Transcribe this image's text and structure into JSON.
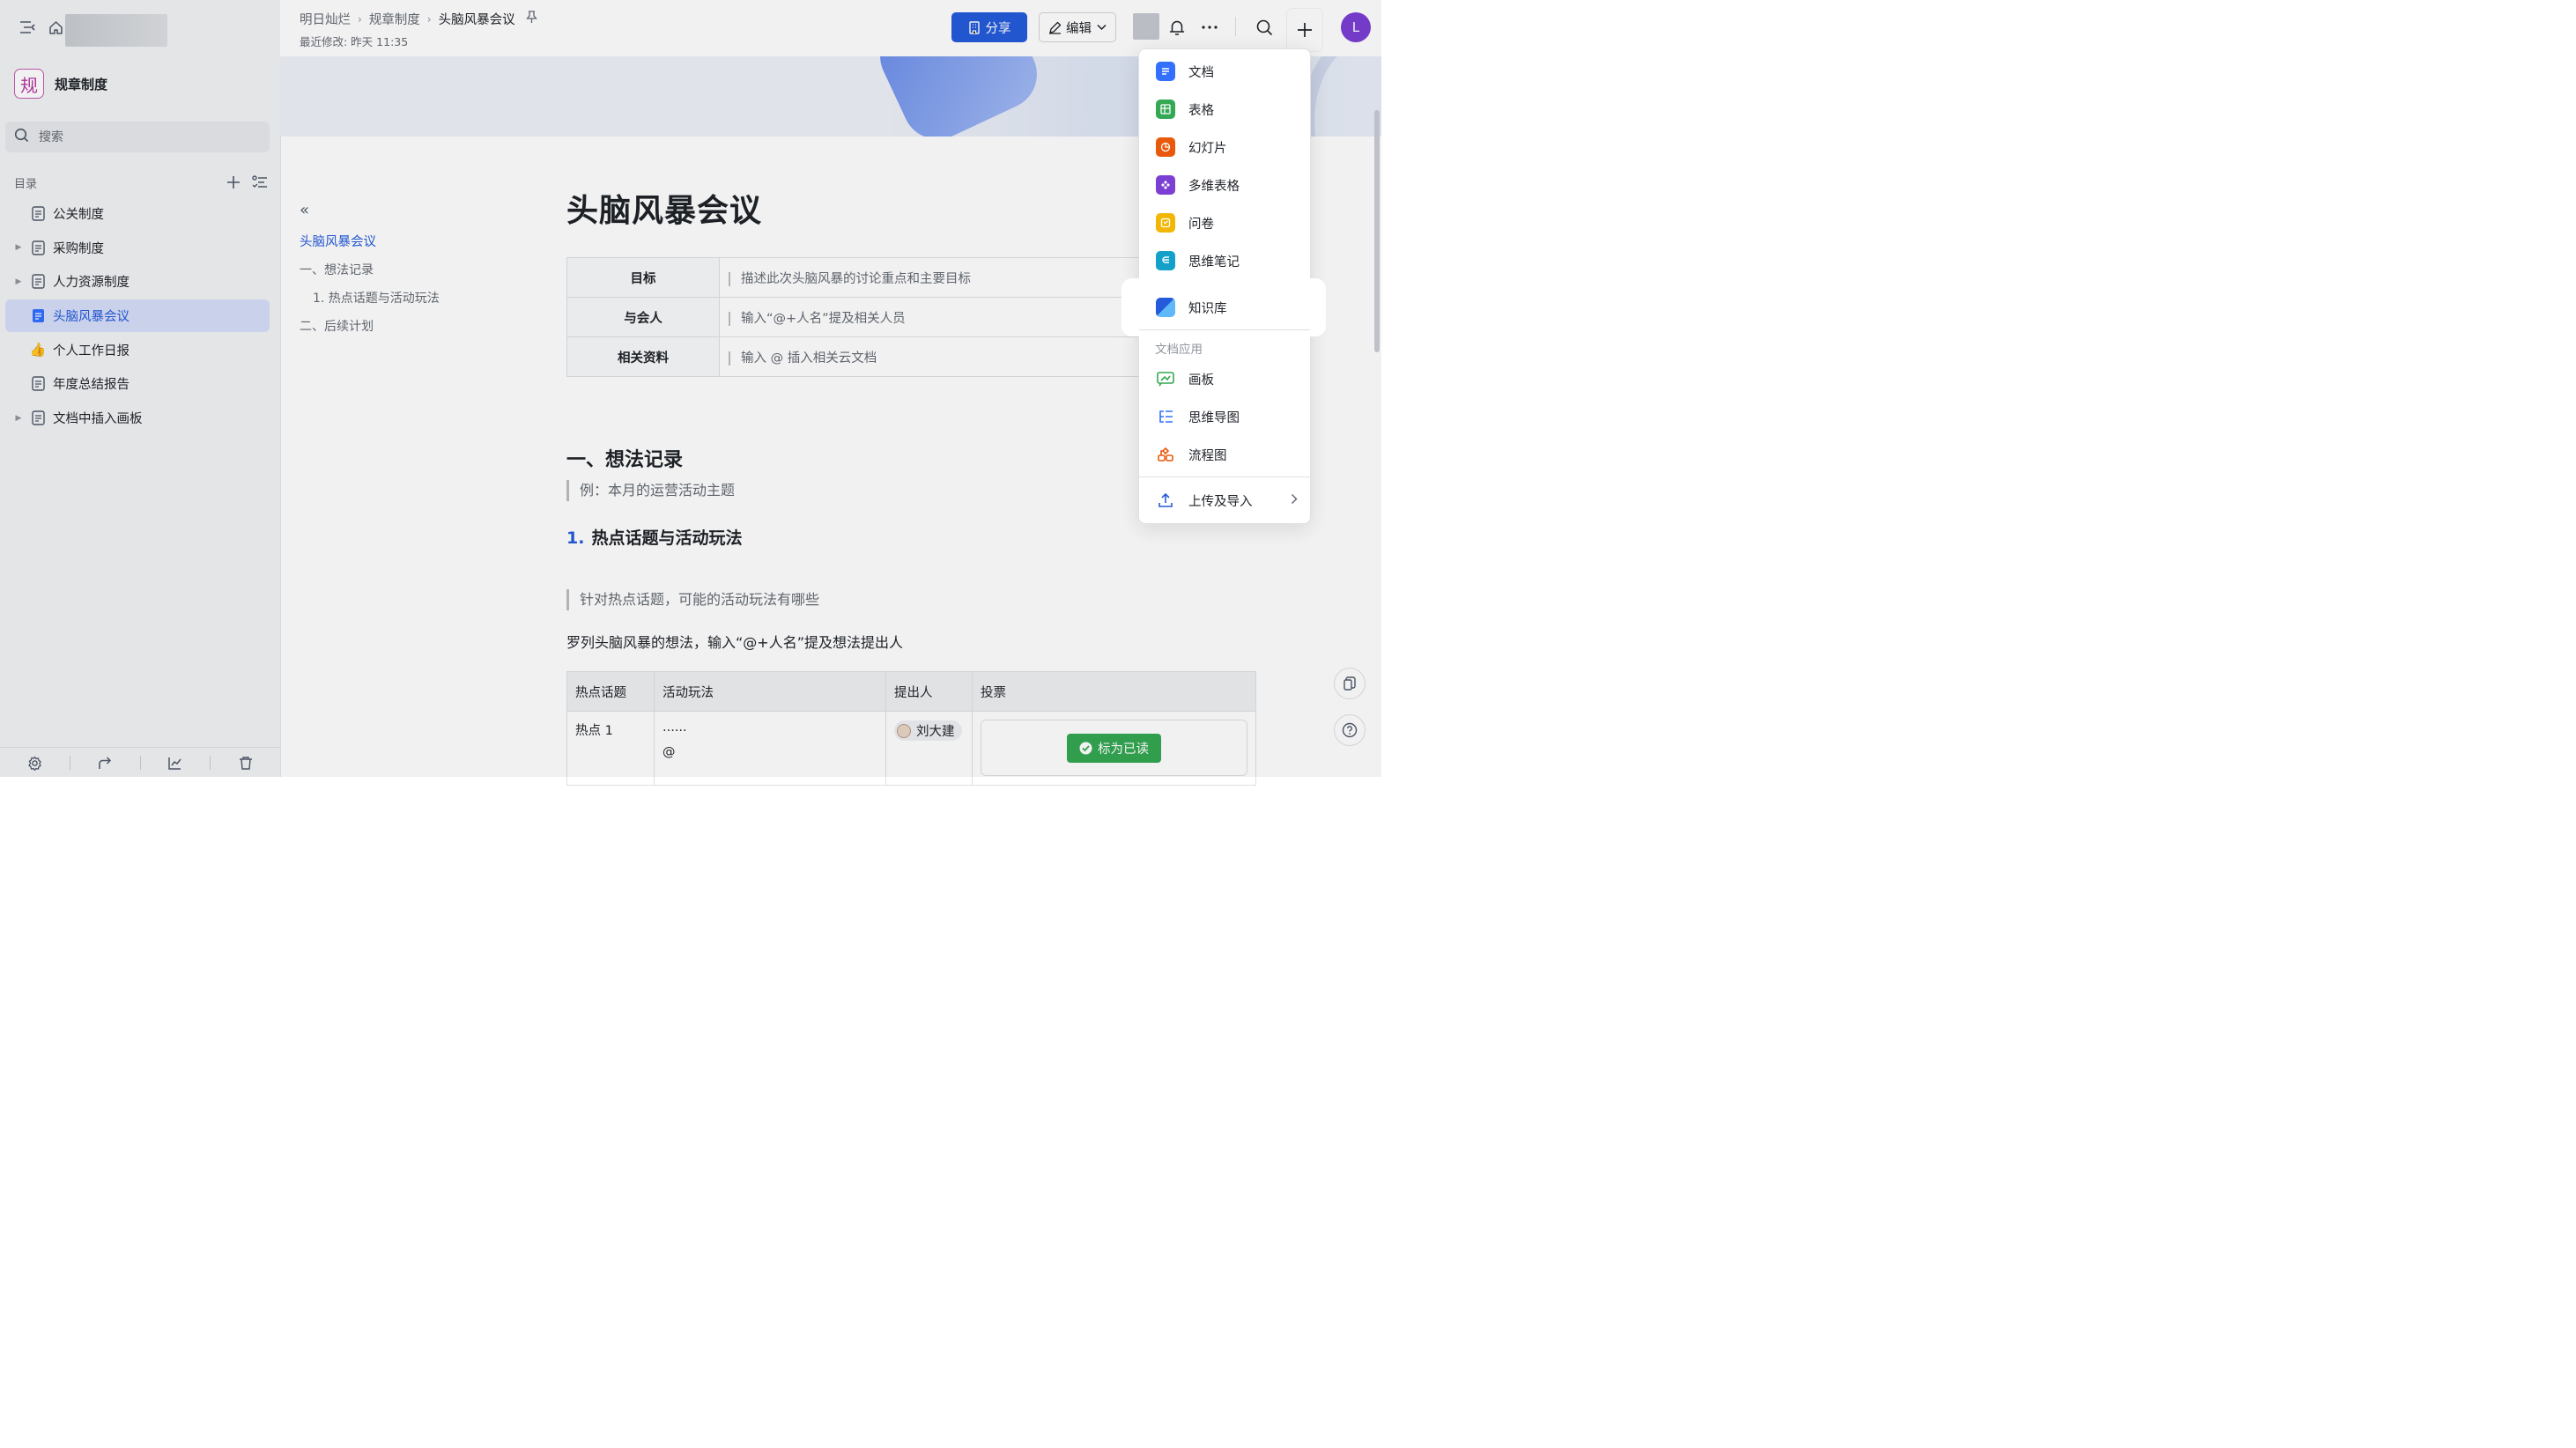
{
  "sidebar": {
    "space_logo_char": "规",
    "space_name": "规章制度",
    "search_placeholder": "搜索",
    "toc_label": "目录",
    "items": [
      {
        "label": "公关制度",
        "icon": "doc-icon",
        "expandable": false,
        "active": false
      },
      {
        "label": "采购制度",
        "icon": "doc-icon",
        "expandable": true,
        "active": false
      },
      {
        "label": "人力资源制度",
        "icon": "doc-icon",
        "expandable": true,
        "active": false
      },
      {
        "label": "头脑风暴会议",
        "icon": "doc-icon",
        "expandable": false,
        "active": true
      },
      {
        "label": "个人工作日报",
        "icon": "thumbs-up-emoji",
        "expandable": false,
        "active": false
      },
      {
        "label": "年度总结报告",
        "icon": "doc-icon",
        "expandable": false,
        "active": false
      },
      {
        "label": "文档中插入画板",
        "icon": "doc-icon",
        "expandable": true,
        "active": false
      }
    ],
    "emoji_thumbs": "👍"
  },
  "header": {
    "breadcrumbs": [
      "明日灿烂",
      "规章制度",
      "头脑风暴会议"
    ],
    "last_modified": "最近修改: 昨天 11:35",
    "share_label": "分享",
    "edit_label": "编辑",
    "avatar_letter": "L"
  },
  "outline": {
    "items": [
      {
        "label": "头脑风暴会议",
        "level": "title"
      },
      {
        "label": "一、想法记录",
        "level": "h1"
      },
      {
        "label": "1. 热点话题与活动玩法",
        "level": "h2"
      },
      {
        "label": "二、后续计划",
        "level": "h1"
      }
    ]
  },
  "doc": {
    "title": "头脑风暴会议",
    "info": [
      {
        "key": "目标",
        "value": "描述此次头脑风暴的讨论重点和主要目标"
      },
      {
        "key": "与会人",
        "value": "输入“@+人名”提及相关人员"
      },
      {
        "key": "相关资料",
        "value": "输入 @ 插入相关云文档"
      }
    ],
    "section1": "一、想法记录",
    "section1_quote": "例：本月的运营活动主题",
    "sub_num": "1.",
    "sub_title": "热点话题与活动玩法",
    "sub_quote": "针对热点话题，可能的活动玩法有哪些",
    "para": "罗列头脑风暴的想法，输入“@+人名”提及想法提出人",
    "table": {
      "headers": [
        "热点话题",
        "活动玩法",
        "提出人",
        "投票"
      ],
      "row1": {
        "topic": "热点 1",
        "play_line1": "......",
        "play_line2": "@",
        "person": "刘大建",
        "vote_button": "标为已读"
      }
    }
  },
  "menu": {
    "items": [
      {
        "label": "文档",
        "color": "#3370ff"
      },
      {
        "label": "表格",
        "color": "#34a853"
      },
      {
        "label": "幻灯片",
        "color": "#e8590c"
      },
      {
        "label": "多维表格",
        "color": "#7b3fd4"
      },
      {
        "label": "问卷",
        "color": "#f2b705"
      },
      {
        "label": "思维笔记",
        "color": "#14a1c9"
      },
      {
        "label": "知识库",
        "color": "#245bdb"
      }
    ],
    "group_label": "文档应用",
    "apps": [
      {
        "label": "画板",
        "color": "#34a853"
      },
      {
        "label": "思维导图",
        "color": "#3370ff"
      },
      {
        "label": "流程图",
        "color": "#e8590c"
      }
    ],
    "upload_label": "上传及导入"
  }
}
